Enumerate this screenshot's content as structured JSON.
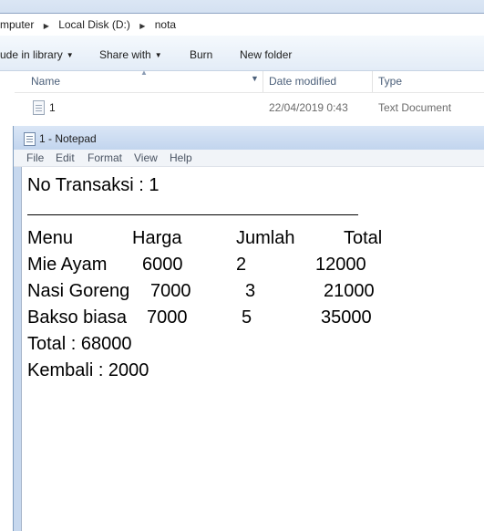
{
  "explorer": {
    "breadcrumb": [
      "mputer",
      "Local Disk (D:)",
      "nota"
    ],
    "toolbar": {
      "include_label": "ude in library",
      "share_label": "Share with",
      "burn_label": "Burn",
      "new_folder_label": "New folder"
    },
    "columns": {
      "name": "Name",
      "date_modified": "Date modified",
      "type": "Type"
    },
    "file": {
      "name": "1",
      "date": "22/04/2019 0:43",
      "type": "Text Document"
    }
  },
  "notepad": {
    "title": "1 - Notepad",
    "menu": [
      "File",
      "Edit",
      "Format",
      "View",
      "Help"
    ],
    "content": {
      "transaction": "No Transaksi : 1",
      "headers": {
        "menu": "Menu",
        "price": "Harga",
        "qty": "Jumlah",
        "total": "Total"
      },
      "rows": [
        {
          "menu": "Mie Ayam",
          "price": "6000",
          "qty": "2",
          "total": "12000"
        },
        {
          "menu": "Nasi Goreng",
          "price": "7000",
          "qty": "3",
          "total": "21000"
        },
        {
          "menu": "Bakso biasa",
          "price": "7000",
          "qty": "5",
          "total": "35000"
        }
      ],
      "grand_total": "Total : 68000",
      "change": "Kembali : 2000"
    }
  }
}
